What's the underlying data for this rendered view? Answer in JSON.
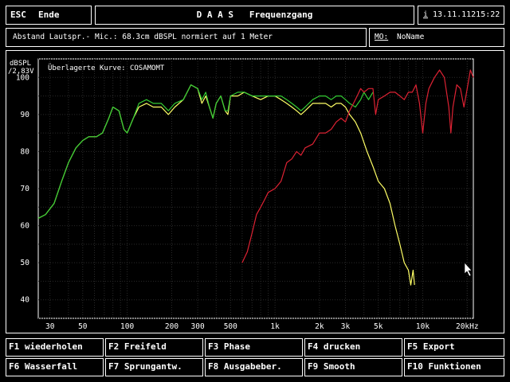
{
  "header": {
    "esc_key": "ESC",
    "esc_label": "Ende",
    "title": "D A A S   Frequenzgang",
    "info_icon": "i",
    "datetime": "13.11.11215:22"
  },
  "subheader": {
    "description": "Abstand Lautspr.- Mic.: 68.3cm dBSPL normiert auf 1 Meter",
    "mo_label": "MO:",
    "mo_value": "NoName"
  },
  "chart_data": {
    "type": "line",
    "ylabel": "dBSPL",
    "ylabel_sub": "/2,83V",
    "annotation": "Überlagerte Kurve: COSAMOMT",
    "x_scale": "log",
    "xlim": [
      25,
      22000
    ],
    "ylim": [
      35,
      105
    ],
    "grid": true,
    "x_ticks": [
      {
        "v": 30,
        "label": "30"
      },
      {
        "v": 50,
        "label": "50"
      },
      {
        "v": 100,
        "label": "100"
      },
      {
        "v": 200,
        "label": "200"
      },
      {
        "v": 300,
        "label": "300"
      },
      {
        "v": 500,
        "label": "500"
      },
      {
        "v": 1000,
        "label": "1k"
      },
      {
        "v": 2000,
        "label": "2k"
      },
      {
        "v": 3000,
        "label": "3k"
      },
      {
        "v": 5000,
        "label": "5k"
      },
      {
        "v": 10000,
        "label": "10k"
      },
      {
        "v": 20000,
        "label": "20kHz"
      }
    ],
    "y_ticks": [
      40,
      50,
      60,
      70,
      80,
      90,
      100
    ],
    "series": [
      {
        "color": "#ffff66",
        "points": [
          [
            25,
            62
          ],
          [
            28,
            63
          ],
          [
            32,
            66
          ],
          [
            36,
            72
          ],
          [
            40,
            77
          ],
          [
            45,
            81
          ],
          [
            50,
            83
          ],
          [
            55,
            84
          ],
          [
            62,
            84
          ],
          [
            68,
            85
          ],
          [
            75,
            89
          ],
          [
            80,
            92
          ],
          [
            88,
            91
          ],
          [
            95,
            86
          ],
          [
            100,
            85
          ],
          [
            110,
            89
          ],
          [
            120,
            92
          ],
          [
            135,
            93
          ],
          [
            150,
            92
          ],
          [
            170,
            92
          ],
          [
            190,
            90
          ],
          [
            210,
            92
          ],
          [
            240,
            94
          ],
          [
            270,
            98
          ],
          [
            300,
            97
          ],
          [
            320,
            93
          ],
          [
            340,
            95
          ],
          [
            360,
            92
          ],
          [
            380,
            89
          ],
          [
            400,
            93
          ],
          [
            430,
            95
          ],
          [
            460,
            91
          ],
          [
            480,
            90
          ],
          [
            500,
            95
          ],
          [
            560,
            95
          ],
          [
            620,
            96
          ],
          [
            700,
            95
          ],
          [
            800,
            94
          ],
          [
            900,
            95
          ],
          [
            1000,
            95
          ],
          [
            1100,
            94
          ],
          [
            1200,
            93
          ],
          [
            1300,
            92
          ],
          [
            1400,
            91
          ],
          [
            1500,
            90
          ],
          [
            1600,
            91
          ],
          [
            1800,
            93
          ],
          [
            2000,
            93
          ],
          [
            2200,
            93
          ],
          [
            2400,
            92
          ],
          [
            2600,
            93
          ],
          [
            2800,
            93
          ],
          [
            3000,
            92
          ],
          [
            3200,
            90
          ],
          [
            3500,
            88
          ],
          [
            3800,
            85
          ],
          [
            4200,
            80
          ],
          [
            4600,
            76
          ],
          [
            5000,
            72
          ],
          [
            5500,
            70
          ],
          [
            6000,
            66
          ],
          [
            6500,
            60
          ],
          [
            7000,
            55
          ],
          [
            7500,
            50
          ],
          [
            8000,
            48
          ],
          [
            8300,
            44
          ],
          [
            8600,
            48
          ],
          [
            8800,
            44
          ]
        ]
      },
      {
        "color": "#33cc33",
        "points": [
          [
            25,
            62
          ],
          [
            28,
            63
          ],
          [
            32,
            66
          ],
          [
            36,
            72
          ],
          [
            40,
            77
          ],
          [
            45,
            81
          ],
          [
            50,
            83
          ],
          [
            55,
            84
          ],
          [
            62,
            84
          ],
          [
            68,
            85
          ],
          [
            75,
            89
          ],
          [
            80,
            92
          ],
          [
            88,
            91
          ],
          [
            95,
            86
          ],
          [
            100,
            85
          ],
          [
            110,
            89
          ],
          [
            120,
            93
          ],
          [
            135,
            94
          ],
          [
            150,
            93
          ],
          [
            170,
            93
          ],
          [
            190,
            91
          ],
          [
            210,
            93
          ],
          [
            240,
            94
          ],
          [
            270,
            98
          ],
          [
            300,
            97
          ],
          [
            320,
            94
          ],
          [
            340,
            96
          ],
          [
            360,
            92
          ],
          [
            380,
            89
          ],
          [
            400,
            93
          ],
          [
            430,
            95
          ],
          [
            460,
            91
          ],
          [
            480,
            91
          ],
          [
            500,
            95
          ],
          [
            560,
            96
          ],
          [
            620,
            96
          ],
          [
            700,
            95
          ],
          [
            800,
            95
          ],
          [
            900,
            95
          ],
          [
            1000,
            95
          ],
          [
            1100,
            95
          ],
          [
            1200,
            94
          ],
          [
            1300,
            93
          ],
          [
            1400,
            92
          ],
          [
            1500,
            91
          ],
          [
            1600,
            92
          ],
          [
            1800,
            94
          ],
          [
            2000,
            95
          ],
          [
            2200,
            95
          ],
          [
            2400,
            94
          ],
          [
            2600,
            95
          ],
          [
            2800,
            95
          ],
          [
            3000,
            94
          ],
          [
            3200,
            93
          ],
          [
            3500,
            92
          ],
          [
            3800,
            94
          ],
          [
            4000,
            96
          ],
          [
            4300,
            94
          ],
          [
            4600,
            96
          ]
        ]
      },
      {
        "color": "#dd2233",
        "points": [
          [
            600,
            50
          ],
          [
            650,
            53
          ],
          [
            700,
            58
          ],
          [
            750,
            63
          ],
          [
            800,
            65
          ],
          [
            850,
            67
          ],
          [
            900,
            69
          ],
          [
            1000,
            70
          ],
          [
            1100,
            72
          ],
          [
            1200,
            77
          ],
          [
            1300,
            78
          ],
          [
            1400,
            80
          ],
          [
            1500,
            79
          ],
          [
            1600,
            81
          ],
          [
            1800,
            82
          ],
          [
            2000,
            85
          ],
          [
            2200,
            85
          ],
          [
            2400,
            86
          ],
          [
            2600,
            88
          ],
          [
            2800,
            89
          ],
          [
            3000,
            88
          ],
          [
            3200,
            91
          ],
          [
            3400,
            93
          ],
          [
            3600,
            95
          ],
          [
            3800,
            97
          ],
          [
            4000,
            96
          ],
          [
            4300,
            97
          ],
          [
            4600,
            97
          ],
          [
            4800,
            90
          ],
          [
            5000,
            94
          ],
          [
            5500,
            95
          ],
          [
            6000,
            96
          ],
          [
            6500,
            96
          ],
          [
            7000,
            95
          ],
          [
            7500,
            94
          ],
          [
            8000,
            96
          ],
          [
            8500,
            96
          ],
          [
            9000,
            98
          ],
          [
            9500,
            93
          ],
          [
            10000,
            85
          ],
          [
            10500,
            93
          ],
          [
            11000,
            97
          ],
          [
            12000,
            100
          ],
          [
            13000,
            102
          ],
          [
            14000,
            100
          ],
          [
            15000,
            92
          ],
          [
            15500,
            85
          ],
          [
            16000,
            92
          ],
          [
            17000,
            98
          ],
          [
            18000,
            97
          ],
          [
            19000,
            92
          ],
          [
            20000,
            97
          ],
          [
            21000,
            102
          ],
          [
            22000,
            100
          ]
        ]
      }
    ]
  },
  "fkeys": {
    "f1": "F1 wiederholen",
    "f2": "F2 Freifeld",
    "f3": "F3 Phase",
    "f4": "F4 drucken",
    "f5": "F5 Export",
    "f6": "F6 Wasserfall",
    "f7": "F7 Sprungantw.",
    "f8": "F8 Ausgabeber.",
    "f9": "F9 Smooth",
    "f10": "F10 Funktionen"
  }
}
